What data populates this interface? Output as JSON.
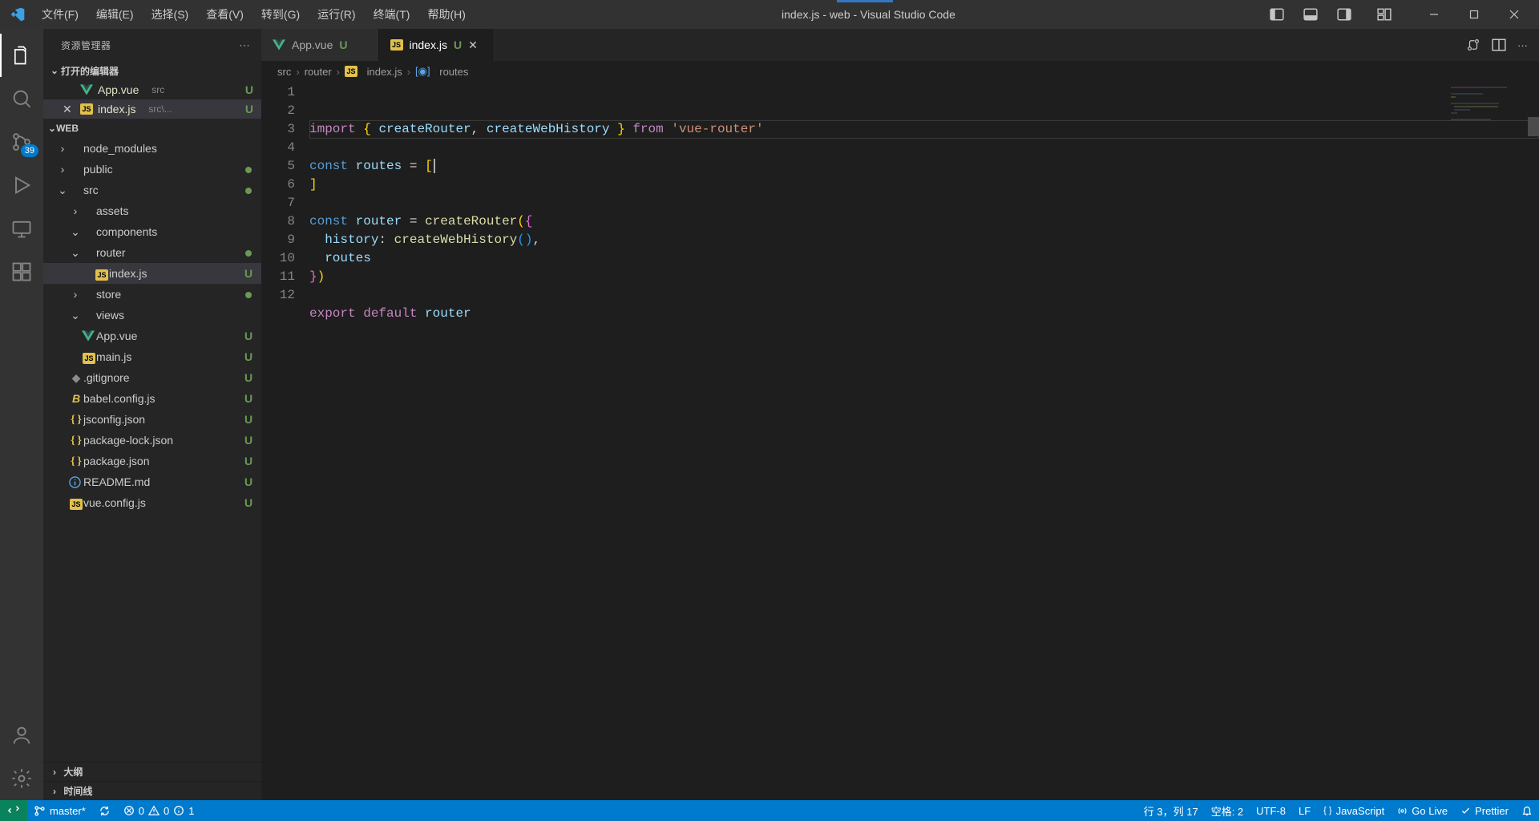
{
  "title": "index.js - web - Visual Studio Code",
  "menu": [
    "文件(F)",
    "编辑(E)",
    "选择(S)",
    "查看(V)",
    "转到(G)",
    "运行(R)",
    "终端(T)",
    "帮助(H)"
  ],
  "activity": {
    "scm_badge": "39"
  },
  "sidebar": {
    "title": "资源管理器",
    "open_editors_label": "打开的编辑器",
    "open_editors": [
      {
        "icon": "vue",
        "name": "App.vue",
        "path": "src",
        "status": "U",
        "selected": false
      },
      {
        "icon": "js",
        "name": "index.js",
        "path": "src\\...",
        "status": "U",
        "selected": true
      }
    ],
    "project_name": "WEB",
    "tree": [
      {
        "depth": 0,
        "twist": ">",
        "icon": "",
        "label": "node_modules",
        "status": ""
      },
      {
        "depth": 0,
        "twist": ">",
        "icon": "",
        "label": "public",
        "status": "dot"
      },
      {
        "depth": 0,
        "twist": "v",
        "icon": "",
        "label": "src",
        "status": "dot"
      },
      {
        "depth": 1,
        "twist": ">",
        "icon": "",
        "label": "assets",
        "status": ""
      },
      {
        "depth": 1,
        "twist": "v",
        "icon": "",
        "label": "components",
        "status": ""
      },
      {
        "depth": 1,
        "twist": "v",
        "icon": "",
        "label": "router",
        "status": "dot"
      },
      {
        "depth": 2,
        "twist": "",
        "icon": "js",
        "label": "index.js",
        "status": "U",
        "selected": true
      },
      {
        "depth": 1,
        "twist": ">",
        "icon": "",
        "label": "store",
        "status": "dot"
      },
      {
        "depth": 1,
        "twist": "v",
        "icon": "",
        "label": "views",
        "status": ""
      },
      {
        "depth": 1,
        "twist": "",
        "icon": "vue",
        "label": "App.vue",
        "status": "U"
      },
      {
        "depth": 1,
        "twist": "",
        "icon": "js",
        "label": "main.js",
        "status": "U"
      },
      {
        "depth": 0,
        "twist": "",
        "icon": "git",
        "label": ".gitignore",
        "status": "U"
      },
      {
        "depth": 0,
        "twist": "",
        "icon": "babel",
        "label": "babel.config.js",
        "status": "U"
      },
      {
        "depth": 0,
        "twist": "",
        "icon": "json",
        "label": "jsconfig.json",
        "status": "U"
      },
      {
        "depth": 0,
        "twist": "",
        "icon": "json",
        "label": "package-lock.json",
        "status": "U"
      },
      {
        "depth": 0,
        "twist": "",
        "icon": "json",
        "label": "package.json",
        "status": "U"
      },
      {
        "depth": 0,
        "twist": "",
        "icon": "info",
        "label": "README.md",
        "status": "U"
      },
      {
        "depth": 0,
        "twist": "",
        "icon": "js",
        "label": "vue.config.js",
        "status": "U"
      }
    ],
    "outline": "大纲",
    "timeline": "时间线"
  },
  "tabs": [
    {
      "icon": "vue",
      "name": "App.vue",
      "status": "U",
      "active": false
    },
    {
      "icon": "js",
      "name": "index.js",
      "status": "U",
      "active": true
    }
  ],
  "breadcrumbs": {
    "src": "src",
    "router": "router",
    "file": "index.js",
    "symbol": "routes"
  },
  "code": {
    "lines": [
      "1",
      "2",
      "3",
      "4",
      "5",
      "6",
      "7",
      "8",
      "9",
      "10",
      "11",
      "12"
    ]
  },
  "status": {
    "branch": "master*",
    "errors": "0",
    "warnings": "0",
    "info": "1",
    "cursor": "行 3，列 17",
    "spaces": "空格: 2",
    "encoding": "UTF-8",
    "eol": "LF",
    "lang": "JavaScript",
    "golive": "Go Live",
    "prettier": "Prettier"
  }
}
